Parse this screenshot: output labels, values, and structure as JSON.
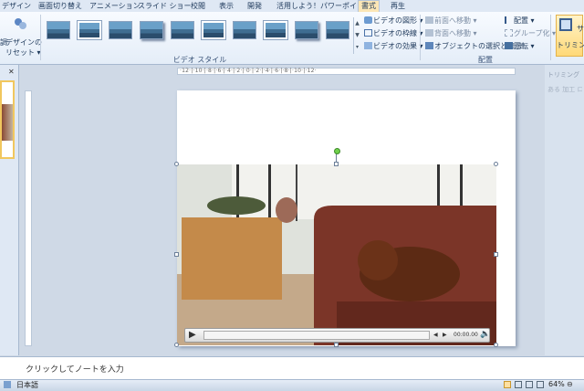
{
  "tabs": [
    {
      "label": "デザイン",
      "selected": false
    },
    {
      "label": "画面切り替え",
      "selected": false
    },
    {
      "label": "アニメーション",
      "selected": false
    },
    {
      "label": "スライド ショー",
      "selected": false
    },
    {
      "label": "校閲",
      "selected": false
    },
    {
      "label": "表示",
      "selected": false
    },
    {
      "label": "開発",
      "selected": false
    },
    {
      "label": "活用しよう！パワーポイント",
      "selected": false
    },
    {
      "label": "書式",
      "selected": true
    },
    {
      "label": "再生",
      "selected": false
    }
  ],
  "ribbon": {
    "reset": {
      "line1": "デザインの",
      "line2": "リセット ▾",
      "left_fragment": "調"
    },
    "video_style_group": "ビデオ スタイル",
    "video_shape": "ビデオの図形 ▾",
    "video_border": "ビデオの枠線 ▾",
    "video_effects": "ビデオの効果 ▾",
    "bring_forward": "前面へ移動 ▾",
    "send_backward": "背面へ移動 ▾",
    "selection_pane": "オブジェクトの選択と表示",
    "align": "配置 ▾",
    "group": "グループ化 ▾",
    "rotate": "回転 ▾",
    "arrange_group": "配置",
    "trim": "トリミング",
    "size_fragment": "サ"
  },
  "right_pane": {
    "title": "トリミング",
    "line": "ある 加工 ロ"
  },
  "ruler_label": "·12·|·10·|·8·|·6·|·4·|·2·|·0·|·2·|·4·|·6·|·8·|·10·|·12·",
  "player": {
    "time": "00:00.00"
  },
  "notes": {
    "placeholder": "クリックしてノートを入力"
  },
  "status": {
    "language": "日本語",
    "zoom": "64%"
  },
  "icons": [
    "reset-design-icon",
    "video-shape-icon",
    "video-border-icon",
    "video-effects-icon",
    "bring-forward-icon",
    "send-backward-icon",
    "selection-pane-icon",
    "align-icon",
    "group-icon",
    "rotate-icon",
    "trim-icon",
    "play-icon",
    "rewind-icon",
    "forward-icon",
    "volume-icon",
    "zoom-out-icon",
    "zoom-in-icon",
    "fit-window-icon"
  ]
}
